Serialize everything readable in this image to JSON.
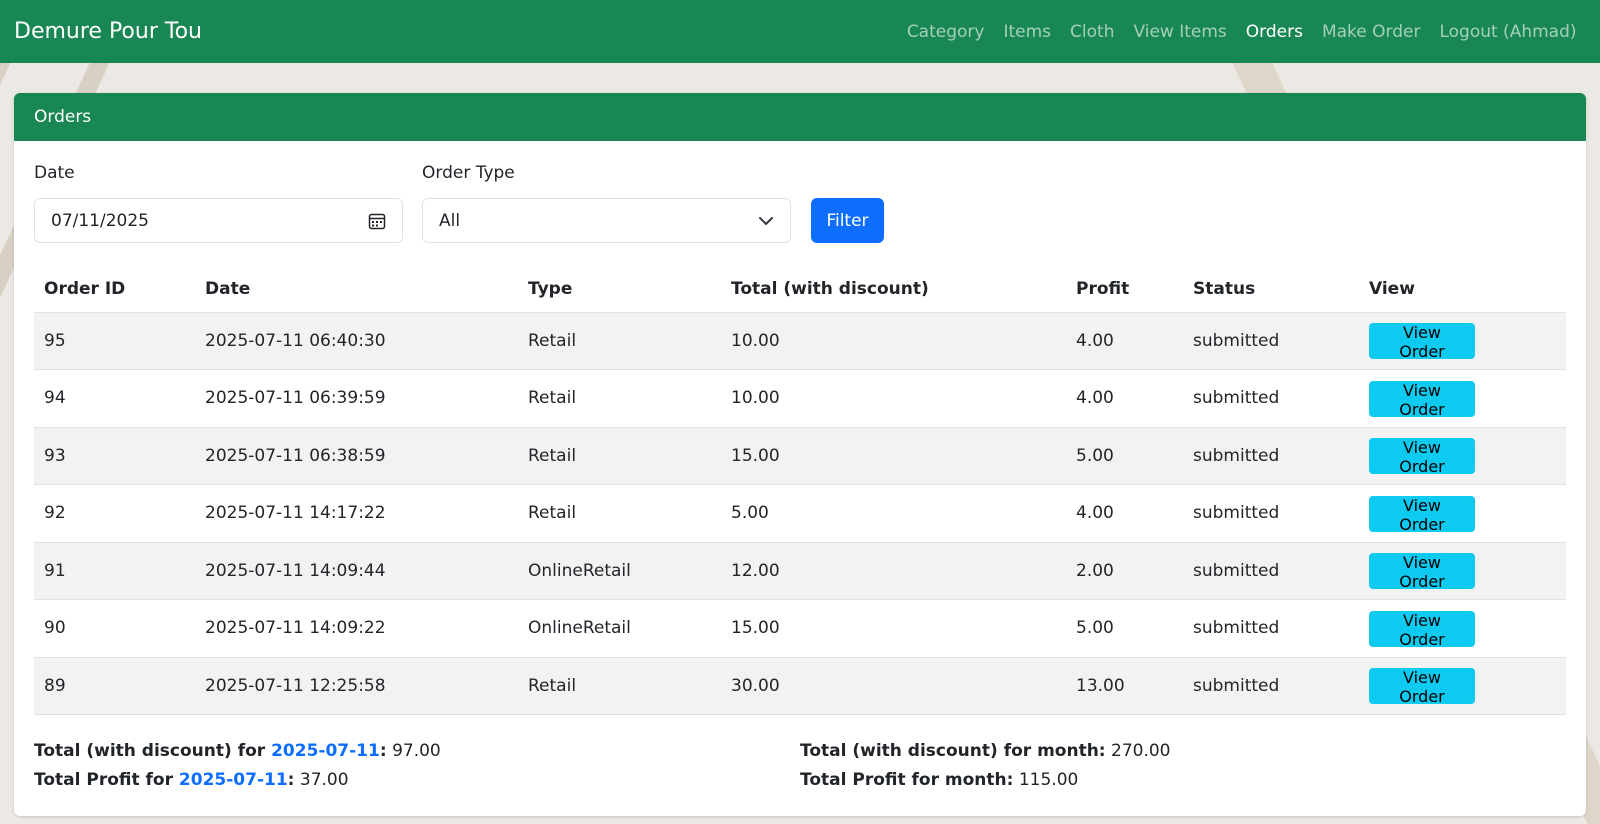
{
  "navbar": {
    "brand": "Demure Pour Tou",
    "links": [
      {
        "label": "Category",
        "active": false
      },
      {
        "label": "Items",
        "active": false
      },
      {
        "label": "Cloth",
        "active": false
      },
      {
        "label": "View Items",
        "active": false
      },
      {
        "label": "Orders",
        "active": true
      },
      {
        "label": "Make Order",
        "active": false
      },
      {
        "label": "Logout (Ahmad)",
        "active": false
      }
    ]
  },
  "card": {
    "title": "Orders"
  },
  "filters": {
    "date_label": "Date",
    "date_value": "07/11/2025",
    "type_label": "Order Type",
    "type_value": "All",
    "filter_button": "Filter"
  },
  "table": {
    "headers": [
      "Order ID",
      "Date",
      "Type",
      "Total (with discount)",
      "Profit",
      "Status",
      "View"
    ],
    "rows": [
      {
        "id": "95",
        "date": "2025-07-11 06:40:30",
        "type": "Retail",
        "total": "10.00",
        "profit": "4.00",
        "status": "submitted",
        "action": "View Order"
      },
      {
        "id": "94",
        "date": "2025-07-11 06:39:59",
        "type": "Retail",
        "total": "10.00",
        "profit": "4.00",
        "status": "submitted",
        "action": "View Order"
      },
      {
        "id": "93",
        "date": "2025-07-11 06:38:59",
        "type": "Retail",
        "total": "15.00",
        "profit": "5.00",
        "status": "submitted",
        "action": "View Order"
      },
      {
        "id": "92",
        "date": "2025-07-11 14:17:22",
        "type": "Retail",
        "total": "5.00",
        "profit": "4.00",
        "status": "submitted",
        "action": "View Order"
      },
      {
        "id": "91",
        "date": "2025-07-11 14:09:44",
        "type": "OnlineRetail",
        "total": "12.00",
        "profit": "2.00",
        "status": "submitted",
        "action": "View Order"
      },
      {
        "id": "90",
        "date": "2025-07-11 14:09:22",
        "type": "OnlineRetail",
        "total": "15.00",
        "profit": "5.00",
        "status": "submitted",
        "action": "View Order"
      },
      {
        "id": "89",
        "date": "2025-07-11 12:25:58",
        "type": "Retail",
        "total": "30.00",
        "profit": "13.00",
        "status": "submitted",
        "action": "View Order"
      }
    ]
  },
  "totals": {
    "day_total_label": "Total (with discount) for ",
    "day_date": "2025-07-11",
    "day_total_value": "97.00",
    "day_profit_label": "Total Profit for ",
    "day_profit_value": "37.00",
    "month_total_label": "Total (with discount) for month:",
    "month_total_value": "270.00",
    "month_profit_label": "Total Profit for month:",
    "month_profit_value": "115.00"
  },
  "colors": {
    "brand_green": "#198754",
    "primary_blue": "#0d6efd",
    "info_cyan": "#0dcaf0"
  },
  "icons": {
    "date_input": "calendar-icon",
    "select": "chevron-down-icon"
  }
}
